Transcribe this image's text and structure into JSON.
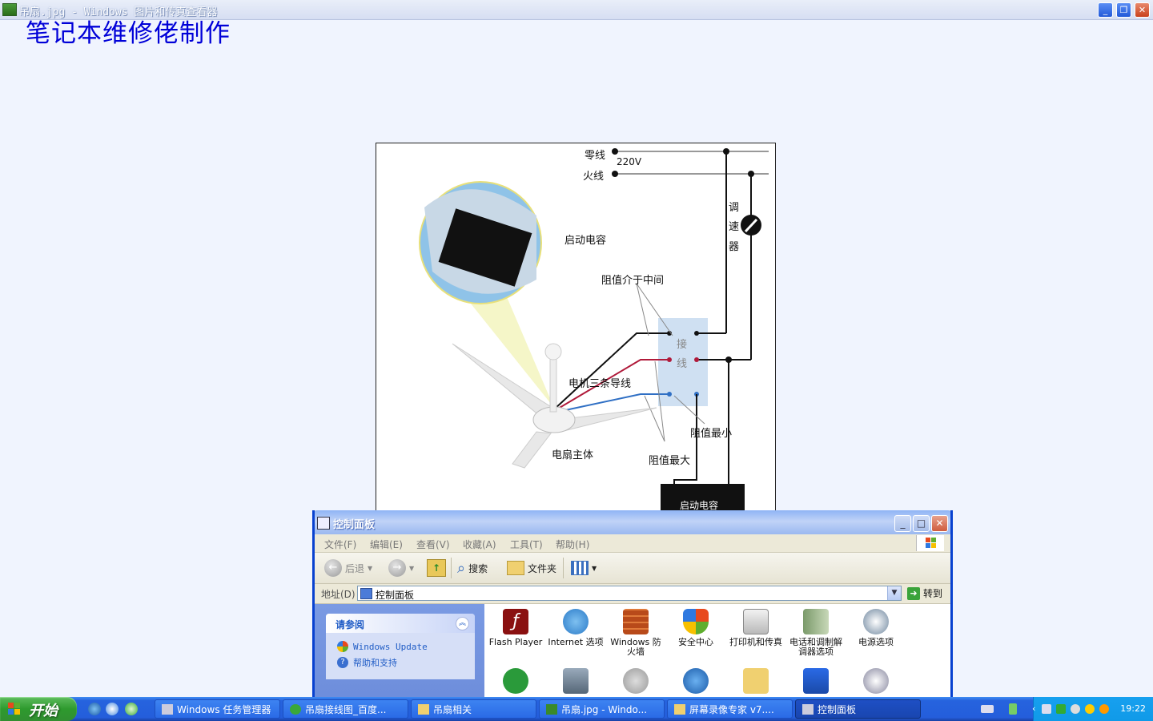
{
  "viewer": {
    "title": "吊扇.jpg - Windows 图片和传真查看器",
    "buttons": {
      "minimize": "_",
      "maximize": "❐",
      "close": "✕"
    }
  },
  "watermark": "笔记本维修佬制作",
  "diagram": {
    "labels": {
      "neutral": "零线",
      "voltage": "220V",
      "live": "火线",
      "speed_controller": [
        "调",
        "速",
        "器"
      ],
      "start_capacitor_top": "启动电容",
      "mid_resistance": "阻值介于中间",
      "terminal": [
        "接",
        "线"
      ],
      "motor_wires": "电机三条导线",
      "min_resistance": "阻值最小",
      "fan_body": "电扇主体",
      "max_resistance": "阻值最大",
      "start_capacitor_box": "启动电容"
    },
    "colors": {
      "black_wire": "#111111",
      "red_wire": "#b01a3a",
      "blue_wire": "#2f6fc4",
      "terminal_box": "#cfe0f2"
    }
  },
  "control_panel": {
    "title": "控制面板",
    "menu": [
      "文件(F)",
      "编辑(E)",
      "查看(V)",
      "收藏(A)",
      "工具(T)",
      "帮助(H)"
    ],
    "toolbar": {
      "back": "后退",
      "search": "搜索",
      "folders": "文件夹"
    },
    "address": {
      "label": "地址(D)",
      "value": "控制面板",
      "go": "转到"
    },
    "see_also": {
      "header": "请参阅",
      "links": [
        "Windows Update",
        "帮助和支持"
      ]
    },
    "items_row1": [
      {
        "label": "Flash Player",
        "icon": "flash-icon"
      },
      {
        "label": "Internet 选项",
        "icon": "internet-options-icon"
      },
      {
        "label": "Windows 防火墙",
        "icon": "firewall-icon"
      },
      {
        "label": "安全中心",
        "icon": "security-center-icon"
      },
      {
        "label": "打印机和传真",
        "icon": "printer-icon"
      },
      {
        "label": "电话和调制解调器选项",
        "icon": "phone-modem-icon"
      },
      {
        "label": "电源选项",
        "icon": "power-options-icon"
      }
    ]
  },
  "taskbar": {
    "start": "开始",
    "tasks": [
      {
        "label": "Windows 任务管理器",
        "active": false
      },
      {
        "label": "吊扇接线图_百度...",
        "active": false
      },
      {
        "label": "吊扇相关",
        "active": false
      },
      {
        "label": "吊扇.jpg - Windo...",
        "active": false
      },
      {
        "label": "屏幕录像专家 v7....",
        "active": false
      },
      {
        "label": "控制面板",
        "active": true
      }
    ],
    "clock": "19:22"
  }
}
